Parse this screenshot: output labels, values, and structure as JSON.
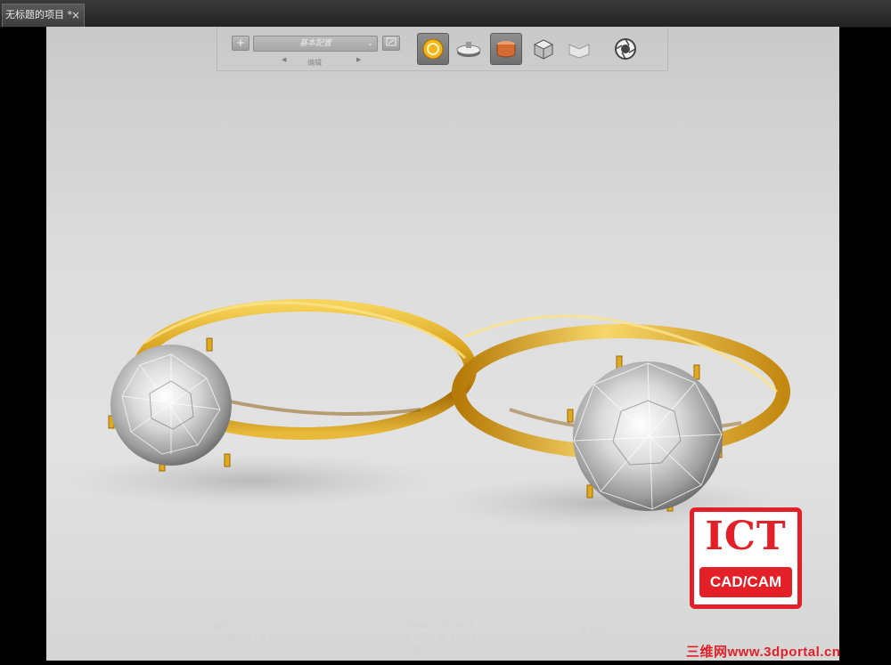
{
  "tab": {
    "title": "无标题的项目 *",
    "close": "×"
  },
  "toolbar": {
    "add": "+",
    "preset_value": "基本配置",
    "preset_arrow": "⌄",
    "edit_label": "编辑",
    "nav_prev": "◀",
    "nav_next": "▶",
    "tools": [
      {
        "name": "environment-tool-icon",
        "active": true
      },
      {
        "name": "turntable-tool-icon",
        "active": false
      },
      {
        "name": "material-tool-icon",
        "active": true
      },
      {
        "name": "geometry-tool-icon",
        "active": false
      },
      {
        "name": "scene-tool-icon",
        "active": false
      },
      {
        "name": "camera-aperture-tool-icon",
        "active": false
      }
    ]
  },
  "hud": {
    "left_line1": "遍历 : 6",
    "left_line2": "每秒遍历数 : 0.18",
    "center_line1": "分辨率: 1022x818",
    "center_line2": "多边形计数: 53832",
    "center_line3": "距离: 91.15(mm)",
    "right_line1": "仅 CPU"
  },
  "watermark": {
    "logo_top": "ICT",
    "logo_bottom": "CAD/CAM",
    "site": "三维网www.3dportal.cn"
  },
  "colors": {
    "gold": "#d9a21a",
    "viewport_bg": "#dcdcdc",
    "logo_red": "#e32028"
  }
}
